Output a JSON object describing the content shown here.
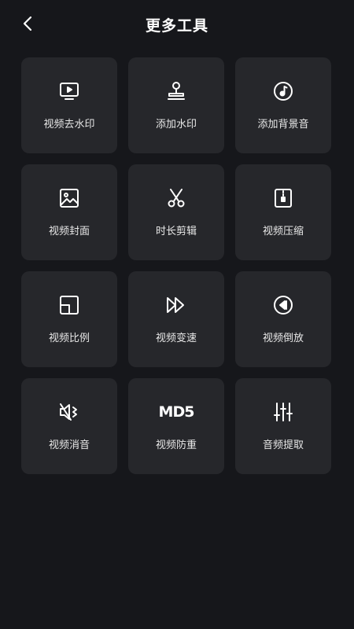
{
  "header": {
    "title": "更多工具",
    "back_icon": "chevron-left-icon"
  },
  "tools": [
    {
      "label": "视频去水印",
      "icon": "tv-play-icon"
    },
    {
      "label": "添加水印",
      "icon": "stamp-icon"
    },
    {
      "label": "添加背景音",
      "icon": "music-disc-icon"
    },
    {
      "label": "视频封面",
      "icon": "image-icon"
    },
    {
      "label": "时长剪辑",
      "icon": "scissors-icon"
    },
    {
      "label": "视频压缩",
      "icon": "zip-file-icon"
    },
    {
      "label": "视频比例",
      "icon": "aspect-ratio-icon"
    },
    {
      "label": "视频变速",
      "icon": "fast-forward-icon"
    },
    {
      "label": "视频倒放",
      "icon": "rewind-circle-icon"
    },
    {
      "label": "视频消音",
      "icon": "mute-icon"
    },
    {
      "label": "视频防重",
      "icon": "md5-icon",
      "icon_text": "MD5"
    },
    {
      "label": "音频提取",
      "icon": "sliders-icon"
    }
  ]
}
